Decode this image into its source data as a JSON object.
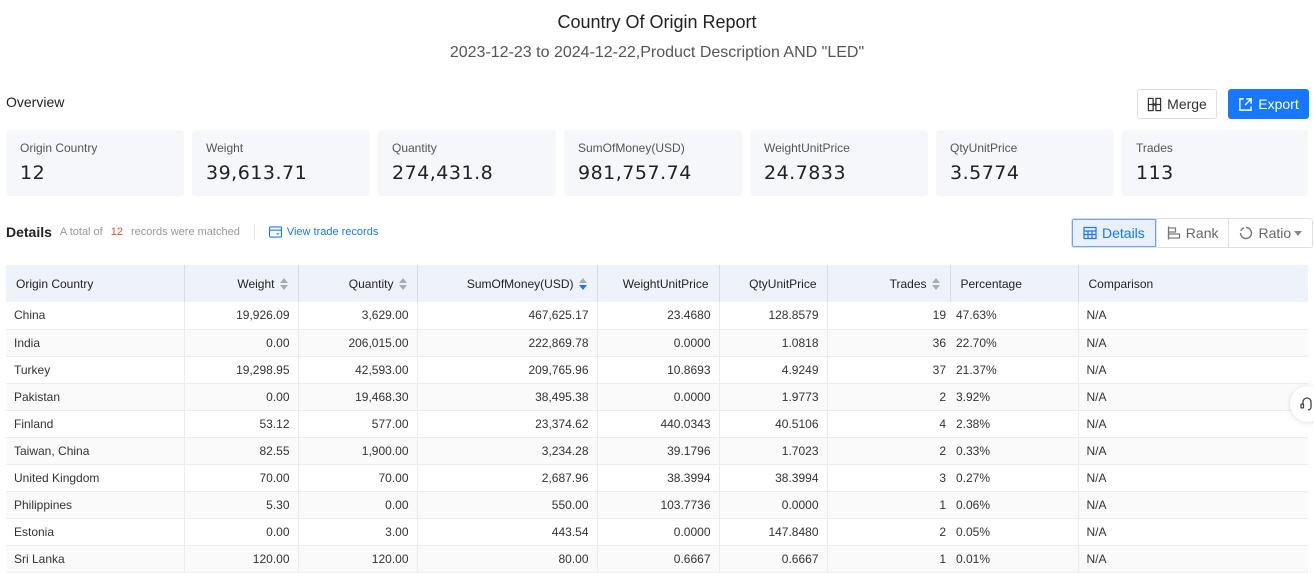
{
  "header": {
    "title": "Country Of Origin Report",
    "subtitle": "2023-12-23 to 2024-12-22,Product Description AND \"LED\""
  },
  "overview": {
    "label": "Overview",
    "merge_label": "Merge",
    "export_label": "Export",
    "cards": [
      {
        "label": "Origin Country",
        "value": "12"
      },
      {
        "label": "Weight",
        "value": "39,613.71"
      },
      {
        "label": "Quantity",
        "value": "274,431.8"
      },
      {
        "label": "SumOfMoney(USD)",
        "value": "981,757.74"
      },
      {
        "label": "WeightUnitPrice",
        "value": "24.7833"
      },
      {
        "label": "QtyUnitPrice",
        "value": "3.5774"
      },
      {
        "label": "Trades",
        "value": "113"
      }
    ]
  },
  "details": {
    "title": "Details",
    "prefix": "A total of",
    "count": "12",
    "suffix": "records were matched",
    "view_link": "View trade records",
    "views": [
      {
        "label": "Details",
        "icon": "table-icon",
        "active": true
      },
      {
        "label": "Rank",
        "icon": "bar-rank-icon",
        "active": false
      },
      {
        "label": "Ratio",
        "icon": "ratio-icon",
        "active": false
      }
    ]
  },
  "table": {
    "columns": [
      "Origin Country",
      "Weight",
      "Quantity",
      "SumOfMoney(USD)",
      "WeightUnitPrice",
      "QtyUnitPrice",
      "Trades",
      "Percentage",
      "Comparison"
    ],
    "rows": [
      [
        "China",
        "19,926.09",
        "3,629.00",
        "467,625.17",
        "23.4680",
        "128.8579",
        "19",
        "47.63%",
        "N/A"
      ],
      [
        "India",
        "0.00",
        "206,015.00",
        "222,869.78",
        "0.0000",
        "1.0818",
        "36",
        "22.70%",
        "N/A"
      ],
      [
        "Turkey",
        "19,298.95",
        "42,593.00",
        "209,765.96",
        "10.8693",
        "4.9249",
        "37",
        "21.37%",
        "N/A"
      ],
      [
        "Pakistan",
        "0.00",
        "19,468.30",
        "38,495.38",
        "0.0000",
        "1.9773",
        "2",
        "3.92%",
        "N/A"
      ],
      [
        "Finland",
        "53.12",
        "577.00",
        "23,374.62",
        "440.0343",
        "40.5106",
        "4",
        "2.38%",
        "N/A"
      ],
      [
        "Taiwan, China",
        "82.55",
        "1,900.00",
        "3,234.28",
        "39.1796",
        "1.7023",
        "2",
        "0.33%",
        "N/A"
      ],
      [
        "United Kingdom",
        "70.00",
        "70.00",
        "2,687.96",
        "38.3994",
        "38.3994",
        "3",
        "0.27%",
        "N/A"
      ],
      [
        "Philippines",
        "5.30",
        "0.00",
        "550.00",
        "103.7736",
        "0.0000",
        "1",
        "0.06%",
        "N/A"
      ],
      [
        "Estonia",
        "0.00",
        "3.00",
        "443.54",
        "0.0000",
        "147.8480",
        "2",
        "0.05%",
        "N/A"
      ],
      [
        "Sri Lanka",
        "120.00",
        "120.00",
        "80.00",
        "0.6667",
        "0.6667",
        "1",
        "0.01%",
        "N/A"
      ]
    ]
  },
  "colors": {
    "accent": "#1677ff",
    "count": "#e54b3c",
    "header_bg": "#eef2fb",
    "card_bg": "#f6f7fa"
  }
}
